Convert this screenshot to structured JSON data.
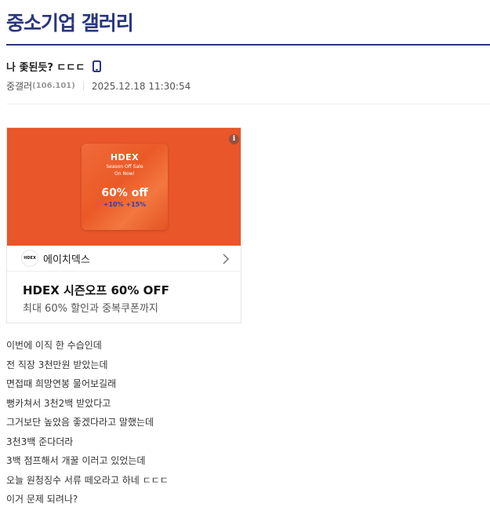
{
  "gallery": {
    "title": "중소기업 갤러리"
  },
  "post": {
    "title": "나 좇된듯? ㄷㄷㄷ",
    "author": "중갤러",
    "ip": "(106.101)",
    "date": "2025.12.18 11:30:54",
    "body": [
      "이번에 이직 한 수습인데",
      "전 직장 3천만원 받았는데",
      "면접때 희망연봉 물어보길래",
      "뻥카쳐서 3천2백 받았다고",
      "그거보단 높았음 좋겠다라고 말했는데",
      "3천3백 준다더라",
      "3백 점프해서 개꿀 이러고 있었는데",
      "오늘 원청징수 서류 떼오라고 하네 ㄷㄷㄷ",
      "이거 문제 되려나?"
    ]
  },
  "ad": {
    "poster_brand": "HDEX",
    "poster_sub_1": "Season Off Sale",
    "poster_sub_2": "On Now!",
    "poster_percent": "60% off",
    "poster_extra": "+10% +15%",
    "info_badge": "i",
    "logo_text": "HDEX",
    "advertiser": "에이치덱스",
    "headline": "HDEX 시즌오프 60% OFF",
    "description": "최대 60% 할인과 중복쿠폰까지"
  },
  "colors": {
    "accent": "#29367c",
    "ad_orange": "#e8562a",
    "ad_blue": "#2a3fb0"
  },
  "icons": {
    "mobile": "mobile-phone-icon",
    "chevron": "chevron-right-icon",
    "info": "info-icon"
  }
}
